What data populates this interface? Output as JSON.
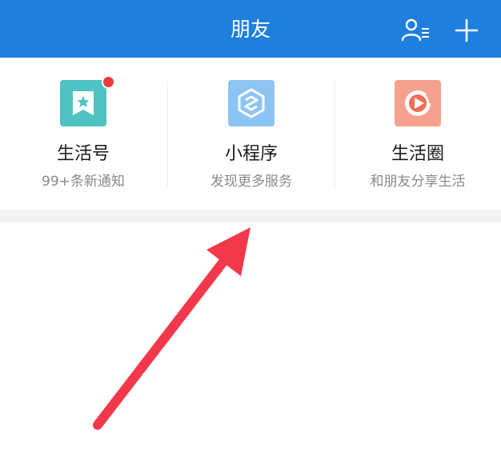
{
  "header": {
    "title": "朋友",
    "contacts_icon": "contacts-icon",
    "add_icon": "plus-icon",
    "bg_color": "#1f7fdc"
  },
  "features": [
    {
      "label": "生活号",
      "sub": "99+条新通知",
      "icon": "life-account-icon",
      "icon_color": "#4fc2c3",
      "has_badge": true
    },
    {
      "label": "小程序",
      "sub": "发现更多服务",
      "icon": "mini-program-icon",
      "icon_color": "#8ec4f3"
    },
    {
      "label": "生活圈",
      "sub": "和朋友分享生活",
      "icon": "life-circle-icon",
      "icon_color": "#f6a08e"
    }
  ],
  "annotation": {
    "arrow_color": "#f2394c",
    "points_to": "小程序"
  }
}
